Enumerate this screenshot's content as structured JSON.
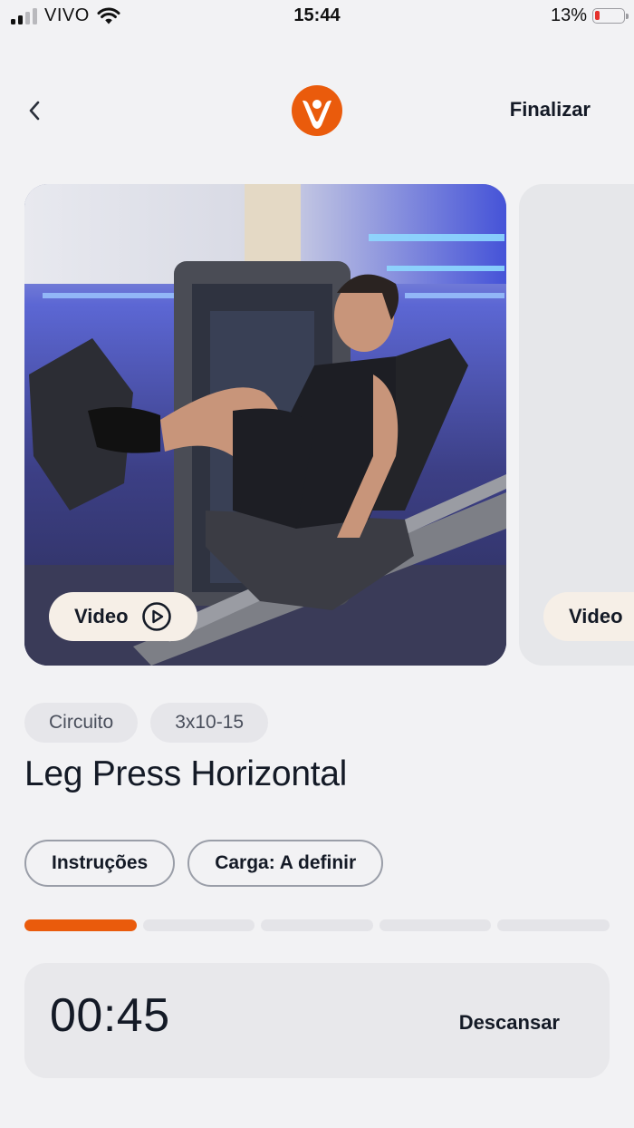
{
  "status_bar": {
    "carrier": "VIVO",
    "time": "15:44",
    "battery": "13%",
    "icons": [
      "signal-icon",
      "wifi-icon",
      "battery-icon"
    ]
  },
  "header": {
    "back_icon": "chevron-left-icon",
    "logo_icon": "brand-v-logo",
    "finish_label": "Finalizar"
  },
  "carousel": {
    "cards": [
      {
        "video_label": "Video",
        "icon": "play-circle-icon",
        "image": "leg press machine exercise photo"
      },
      {
        "video_label": "Video"
      }
    ]
  },
  "exercise": {
    "tags": [
      "Circuito",
      "3x10-15"
    ],
    "title": "Leg Press Horizontal",
    "chips": [
      "Instruções",
      "Carga: A definir"
    ]
  },
  "progress": {
    "total_segments": 5,
    "current_segment": 1
  },
  "rest": {
    "timer": "00:45",
    "action_label": "Descansar"
  },
  "colors": {
    "accent": "#ea5b0c",
    "background": "#f2f2f4",
    "text": "#141a26",
    "pill": "#f6efe7"
  }
}
